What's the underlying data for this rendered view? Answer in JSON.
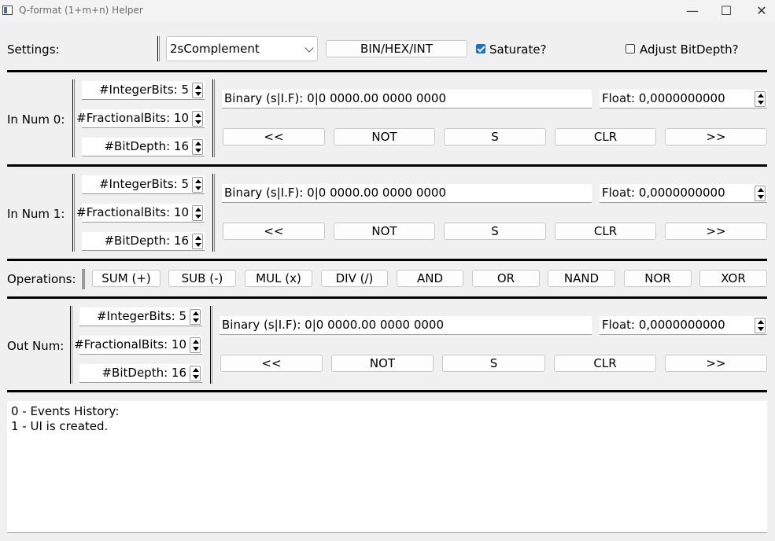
{
  "window": {
    "title": "Q-format (1+m+n) Helper",
    "minimize_glyph": "—",
    "maximize_glyph": "☐",
    "close_glyph": "✕"
  },
  "settings": {
    "label": "Settings:",
    "mode_select": "2sComplement",
    "display_button": "BIN/HEX/INT",
    "saturate_label": "Saturate?",
    "saturate_checked": true,
    "adjust_label": "Adjust BitDepth?",
    "adjust_checked": false
  },
  "in0": {
    "label": "In Num 0:",
    "integer_bits": "#IntegerBits: 5",
    "fractional_bits": "#FractionalBits: 10",
    "bit_depth": "#BitDepth: 16",
    "binary": "Binary (s|I.F): 0|0 0000.00 0000 0000",
    "float": "Float: 0,0000000000",
    "buttons": [
      "<<",
      "NOT",
      "S",
      "CLR",
      ">>"
    ]
  },
  "in1": {
    "label": "In Num 1:",
    "integer_bits": "#IntegerBits: 5",
    "fractional_bits": "#FractionalBits: 10",
    "bit_depth": "#BitDepth: 16",
    "binary": "Binary (s|I.F): 0|0 0000.00 0000 0000",
    "float": "Float: 0,0000000000",
    "buttons": [
      "<<",
      "NOT",
      "S",
      "CLR",
      ">>"
    ]
  },
  "operations": {
    "label": "Operations:",
    "buttons": [
      "SUM (+)",
      "SUB (-)",
      "MUL (x)",
      "DIV (/)",
      "AND",
      "OR",
      "NAND",
      "NOR",
      "XOR"
    ]
  },
  "out": {
    "label": "Out Num:",
    "integer_bits": "#IntegerBits: 5",
    "fractional_bits": "#FractionalBits: 10",
    "bit_depth": "#BitDepth: 16",
    "binary": "Binary (s|I.F): 0|0 0000.00 0000 0000",
    "float": "Float: 0,0000000000",
    "buttons": [
      "<<",
      "NOT",
      "S",
      "CLR",
      ">>"
    ]
  },
  "history": {
    "lines": [
      "0 - Events History:",
      "1 - UI is created."
    ]
  }
}
